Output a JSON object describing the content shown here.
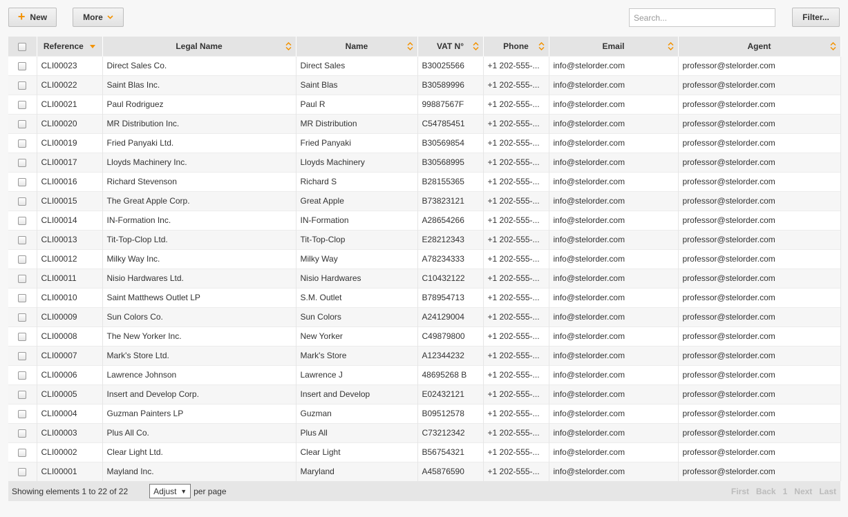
{
  "toolbar": {
    "new_label": "New",
    "more_label": "More",
    "search_placeholder": "Search...",
    "filter_label": "Filter..."
  },
  "colors": {
    "accent": "#f39200",
    "header_bg": "#e4e4e4"
  },
  "columns": [
    {
      "key": "reference",
      "label": "Reference"
    },
    {
      "key": "legal_name",
      "label": "Legal Name"
    },
    {
      "key": "name",
      "label": "Name"
    },
    {
      "key": "vat",
      "label": "VAT N°"
    },
    {
      "key": "phone",
      "label": "Phone"
    },
    {
      "key": "email",
      "label": "Email"
    },
    {
      "key": "agent",
      "label": "Agent"
    }
  ],
  "rows": [
    [
      "CLI00023",
      "Direct Sales Co.",
      "Direct Sales",
      "B30025566",
      "+1 202-555-...",
      "info@stelorder.com",
      "professor@stelorder.com"
    ],
    [
      "CLI00022",
      "Saint Blas Inc.",
      "Saint Blas",
      "B30589996",
      "+1 202-555-...",
      "info@stelorder.com",
      "professor@stelorder.com"
    ],
    [
      "CLI00021",
      "Paul Rodriguez",
      "Paul R",
      "99887567F",
      "+1 202-555-...",
      "info@stelorder.com",
      "professor@stelorder.com"
    ],
    [
      "CLI00020",
      "MR Distribution Inc.",
      "MR Distribution",
      "C54785451",
      "+1 202-555-...",
      "info@stelorder.com",
      "professor@stelorder.com"
    ],
    [
      "CLI00019",
      "Fried Panyaki Ltd.",
      "Fried Panyaki",
      "B30569854",
      "+1 202-555-...",
      "info@stelorder.com",
      "professor@stelorder.com"
    ],
    [
      "CLI00017",
      "Lloyds Machinery Inc.",
      "Lloyds Machinery",
      "B30568995",
      "+1 202-555-...",
      "info@stelorder.com",
      "professor@stelorder.com"
    ],
    [
      "CLI00016",
      "Richard Stevenson",
      "Richard S",
      "B28155365",
      "+1 202-555-...",
      "info@stelorder.com",
      "professor@stelorder.com"
    ],
    [
      "CLI00015",
      "The Great Apple Corp.",
      "Great Apple",
      "B73823121",
      "+1 202-555-...",
      "info@stelorder.com",
      "professor@stelorder.com"
    ],
    [
      "CLI00014",
      "IN-Formation Inc.",
      "IN-Formation",
      "A28654266",
      "+1 202-555-...",
      "info@stelorder.com",
      "professor@stelorder.com"
    ],
    [
      "CLI00013",
      "Tit-Top-Clop Ltd.",
      "Tit-Top-Clop",
      "E28212343",
      "+1 202-555-...",
      "info@stelorder.com",
      "professor@stelorder.com"
    ],
    [
      "CLI00012",
      "Milky Way Inc.",
      "Milky Way",
      "A78234333",
      "+1 202-555-...",
      "info@stelorder.com",
      "professor@stelorder.com"
    ],
    [
      "CLI00011",
      "Nisio Hardwares Ltd.",
      "Nisio Hardwares",
      "C10432122",
      "+1 202-555-...",
      "info@stelorder.com",
      "professor@stelorder.com"
    ],
    [
      "CLI00010",
      "Saint Matthews Outlet LP",
      "S.M. Outlet",
      "B78954713",
      "+1 202-555-...",
      "info@stelorder.com",
      "professor@stelorder.com"
    ],
    [
      "CLI00009",
      "Sun Colors Co.",
      "Sun Colors",
      "A24129004",
      "+1 202-555-...",
      "info@stelorder.com",
      "professor@stelorder.com"
    ],
    [
      "CLI00008",
      "The New Yorker Inc.",
      "New Yorker",
      "C49879800",
      "+1 202-555-...",
      "info@stelorder.com",
      "professor@stelorder.com"
    ],
    [
      "CLI00007",
      "Mark's Store Ltd.",
      "Mark's Store",
      "A12344232",
      "+1 202-555-...",
      "info@stelorder.com",
      "professor@stelorder.com"
    ],
    [
      "CLI00006",
      "Lawrence Johnson",
      "Lawrence J",
      "48695268 B",
      "+1 202-555-...",
      "info@stelorder.com",
      "professor@stelorder.com"
    ],
    [
      "CLI00005",
      "Insert and Develop Corp.",
      "Insert and Develop",
      "E02432121",
      "+1 202-555-...",
      "info@stelorder.com",
      "professor@stelorder.com"
    ],
    [
      "CLI00004",
      "Guzman Painters LP",
      "Guzman",
      "B09512578",
      "+1 202-555-...",
      "info@stelorder.com",
      "professor@stelorder.com"
    ],
    [
      "CLI00003",
      "Plus All Co.",
      "Plus All",
      "C73212342",
      "+1 202-555-...",
      "info@stelorder.com",
      "professor@stelorder.com"
    ],
    [
      "CLI00002",
      "Clear Light Ltd.",
      "Clear Light",
      "B56754321",
      "+1 202-555-...",
      "info@stelorder.com",
      "professor@stelorder.com"
    ],
    [
      "CLI00001",
      "Mayland Inc.",
      "Maryland",
      "A45876590",
      "+1 202-555-...",
      "info@stelorder.com",
      "professor@stelorder.com"
    ]
  ],
  "footer": {
    "info": "Showing elements 1 to 22 of 22",
    "page_size": "Adjust",
    "per_page": "per page",
    "pager": {
      "first": "First",
      "back": "Back",
      "current": "1",
      "next": "Next",
      "last": "Last"
    }
  }
}
